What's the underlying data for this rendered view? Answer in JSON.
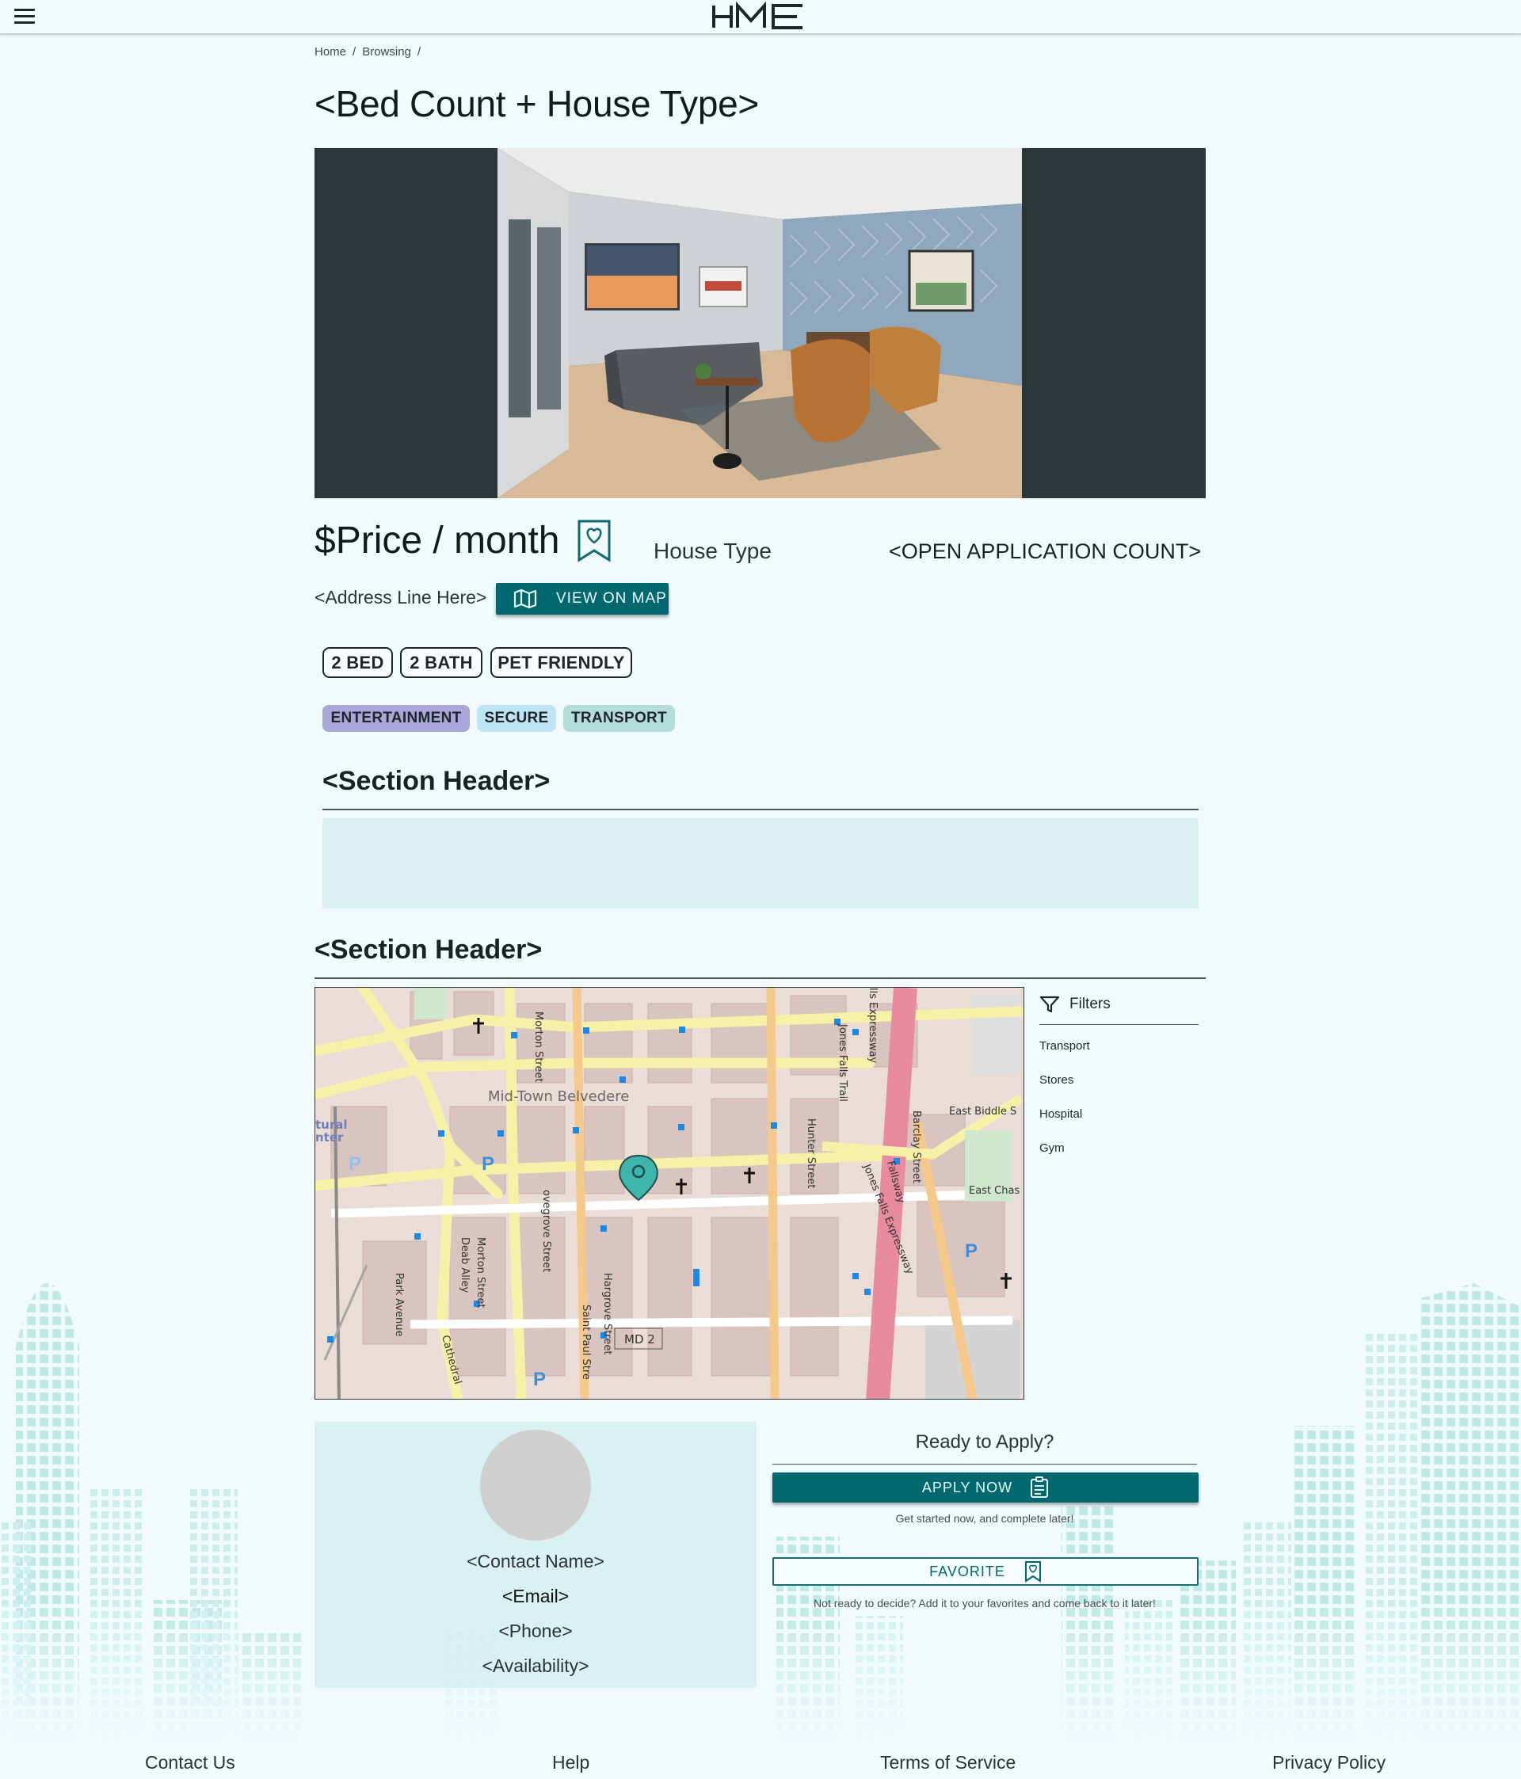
{
  "brand": {
    "logo_text": "HME"
  },
  "breadcrumb": [
    "Home",
    "Browsing"
  ],
  "listing": {
    "title": "<Bed Count + House Type>",
    "price": "$Price / month",
    "house_type": "House Type",
    "open_application_count": "<OPEN APPLICATION COUNT>",
    "address": "<Address Line Here>",
    "view_on_map_label": "VIEW ON MAP",
    "features": [
      "2 BED",
      "2 BATH",
      "PET FRIENDLY"
    ],
    "tags": [
      {
        "label": "ENTERTAINMENT",
        "color": "#a8a7d8"
      },
      {
        "label": "SECURE",
        "color": "#bfe4f4"
      },
      {
        "label": "TRANSPORT",
        "color": "#b4dcd8"
      }
    ]
  },
  "sections": [
    {
      "header": "<Section Header>"
    },
    {
      "header": "<Section Header>"
    }
  ],
  "map": {
    "labels": {
      "district": "Mid-Town Belvedere",
      "morton_st": "Morton Street",
      "jones_falls_trail": "Jones Falls Trail",
      "jones_falls_expressway": "Jones Falls Expressway",
      "falls_expressway": "lls Expressway",
      "hunter_st": "Hunter Street",
      "barclay_st": "Barclay Street",
      "east_biddle": "East Biddle S",
      "east_chase": "East Chas",
      "fallsway": "Fallsway",
      "lovegrove_st": "ovegrove Street",
      "saint_paul_st": "Saint Paul Stre",
      "hargrove_st": "Hargrove Street",
      "park_ave": "Park Avenue",
      "deab_alley": "Deab Alley",
      "cathedral": "Cathedral",
      "route": "MD 2",
      "cultural_center": "tural\nnter"
    }
  },
  "filters": {
    "title": "Filters",
    "items": [
      "Transport",
      "Stores",
      "Hospital",
      "Gym"
    ]
  },
  "contact": {
    "name": "<Contact Name>",
    "email": "<Email>",
    "phone": "<Phone>",
    "availability": "<Availability>"
  },
  "apply": {
    "heading": "Ready to Apply?",
    "apply_label": "APPLY NOW",
    "apply_hint": "Get started now, and complete later!",
    "favorite_label": "FAVORITE",
    "favorite_hint": "Not ready to decide? Add it to your favorites and come back to it later!"
  },
  "footer": [
    "Contact Us",
    "Help",
    "Terms of Service",
    "Privacy Policy"
  ],
  "colors": {
    "accent": "#00686e",
    "background": "#f1fbfd",
    "hero_frame": "#2c3538",
    "section_box": "#dbf0f1",
    "map_pin": "#3fb6ad"
  }
}
